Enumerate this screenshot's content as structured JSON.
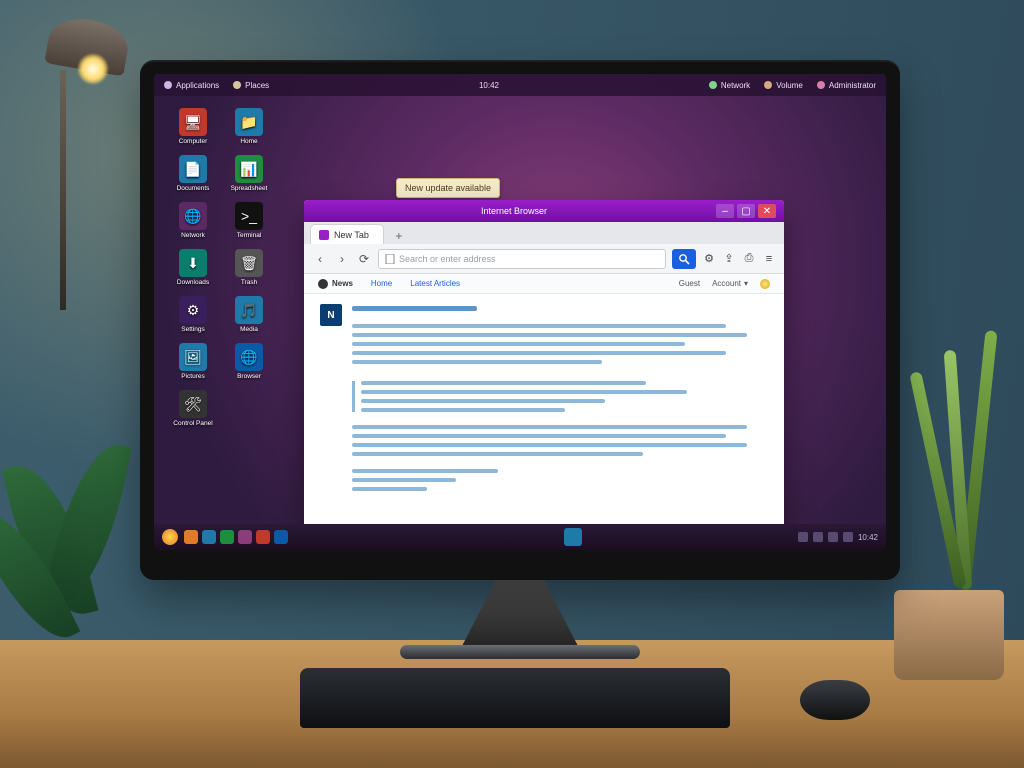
{
  "topbar": {
    "app": "Applications",
    "places": "Places",
    "clock": "10:42",
    "net": "Network",
    "vol": "Volume",
    "user": "Administrator"
  },
  "tooltip": "New update available",
  "desktop_icons": [
    {
      "label": "Computer",
      "glyph": "🖥",
      "bg": "#c0392b"
    },
    {
      "label": "Home",
      "glyph": "📁",
      "bg": "#1e7aa8"
    },
    {
      "label": "Documents",
      "glyph": "📄",
      "bg": "#1e7aa8"
    },
    {
      "label": "Spreadsheet",
      "glyph": "📊",
      "bg": "#1e8e3e"
    },
    {
      "label": "Network",
      "glyph": "🌐",
      "bg": "#5b2a62"
    },
    {
      "label": "Terminal",
      "glyph": ">_",
      "bg": "#111"
    },
    {
      "label": "Downloads",
      "glyph": "⬇",
      "bg": "#0a7d6c"
    },
    {
      "label": "Trash",
      "glyph": "🗑",
      "bg": "#555"
    },
    {
      "label": "Settings",
      "glyph": "⚙",
      "bg": "#3a1f5d"
    },
    {
      "label": "Media",
      "glyph": "🎵",
      "bg": "#1e7aa8"
    },
    {
      "label": "Pictures",
      "glyph": "🖼",
      "bg": "#1e7aa8"
    },
    {
      "label": "Browser",
      "glyph": "🌐",
      "bg": "#0a5aa8"
    },
    {
      "label": "Control Panel",
      "glyph": "🛠",
      "bg": "#333"
    }
  ],
  "taskbar_icons": [
    "#e07b2a",
    "#1e7aa8",
    "#1e8e3e",
    "#8a3d7a",
    "#c0392b",
    "#0a5aa8"
  ],
  "tray_time": "10:42",
  "browser": {
    "title": "Internet Browser",
    "tab": "New Tab",
    "address": "Search or enter address",
    "bookmarks": {
      "site": "News",
      "links": [
        "Home",
        "Latest Articles"
      ],
      "guest": "Guest",
      "account": "Account"
    },
    "post_badge": "N",
    "toolbar_icons": {
      "back": "‹",
      "forward": "›",
      "reload": "⟳",
      "page": "🗎",
      "go": "🔍",
      "settings": "⚙",
      "share": "⇪",
      "print": "⎙",
      "menu": "≡"
    },
    "window_controls": {
      "min": "–",
      "max": "▢",
      "close": "✕"
    }
  }
}
